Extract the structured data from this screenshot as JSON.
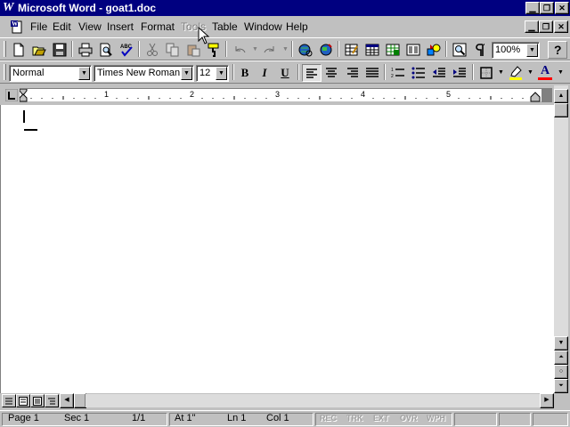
{
  "window": {
    "title": "Microsoft Word - goat1.doc",
    "app_icon": "word-w-icon",
    "controls": [
      "minimize-icon",
      "restore-icon",
      "close-icon"
    ]
  },
  "menubar": {
    "items": [
      {
        "label": "File",
        "enabled": true
      },
      {
        "label": "Edit",
        "enabled": true
      },
      {
        "label": "View",
        "enabled": true
      },
      {
        "label": "Insert",
        "enabled": true
      },
      {
        "label": "Format",
        "enabled": true
      },
      {
        "label": "Tools",
        "enabled": false
      },
      {
        "label": "Table",
        "enabled": true
      },
      {
        "label": "Window",
        "enabled": true
      },
      {
        "label": "Help",
        "enabled": true
      }
    ]
  },
  "standard_toolbar": {
    "zoom": "100%",
    "help_label": "?",
    "icons": [
      "new-document-icon",
      "open-folder-icon",
      "save-disk-icon",
      "print-icon",
      "print-preview-icon",
      "spelling-check-icon",
      "cut-icon",
      "copy-icon",
      "paste-icon",
      "format-painter-icon",
      "undo-icon",
      "redo-icon",
      "insert-hyperlink-icon",
      "web-toolbar-icon",
      "tables-borders-icon",
      "insert-table-icon",
      "insert-excel-icon",
      "columns-icon",
      "drawing-icon",
      "document-map-icon",
      "show-hide-paragraph-icon"
    ]
  },
  "formatting_toolbar": {
    "style": "Normal",
    "font": "Times New Roman",
    "size": "12",
    "bold_label": "B",
    "italic_label": "I",
    "underline_label": "U",
    "font_color_label": "A"
  },
  "ruler": {
    "numbers": [
      "1",
      "2",
      "3",
      "4",
      "5"
    ]
  },
  "statusbar": {
    "page": "Page 1",
    "section": "Sec 1",
    "page_of": "1/1",
    "at": "At 1\"",
    "line": "Ln 1",
    "col": "Col 1",
    "indicators": [
      "REC",
      "TRK",
      "EXT",
      "OVR",
      "WPH"
    ]
  },
  "colors": {
    "titlebar": "#000080",
    "face": "#c0c0c0",
    "highlight_yellow": "#ffff00",
    "font_color_red": "#ff0000"
  }
}
